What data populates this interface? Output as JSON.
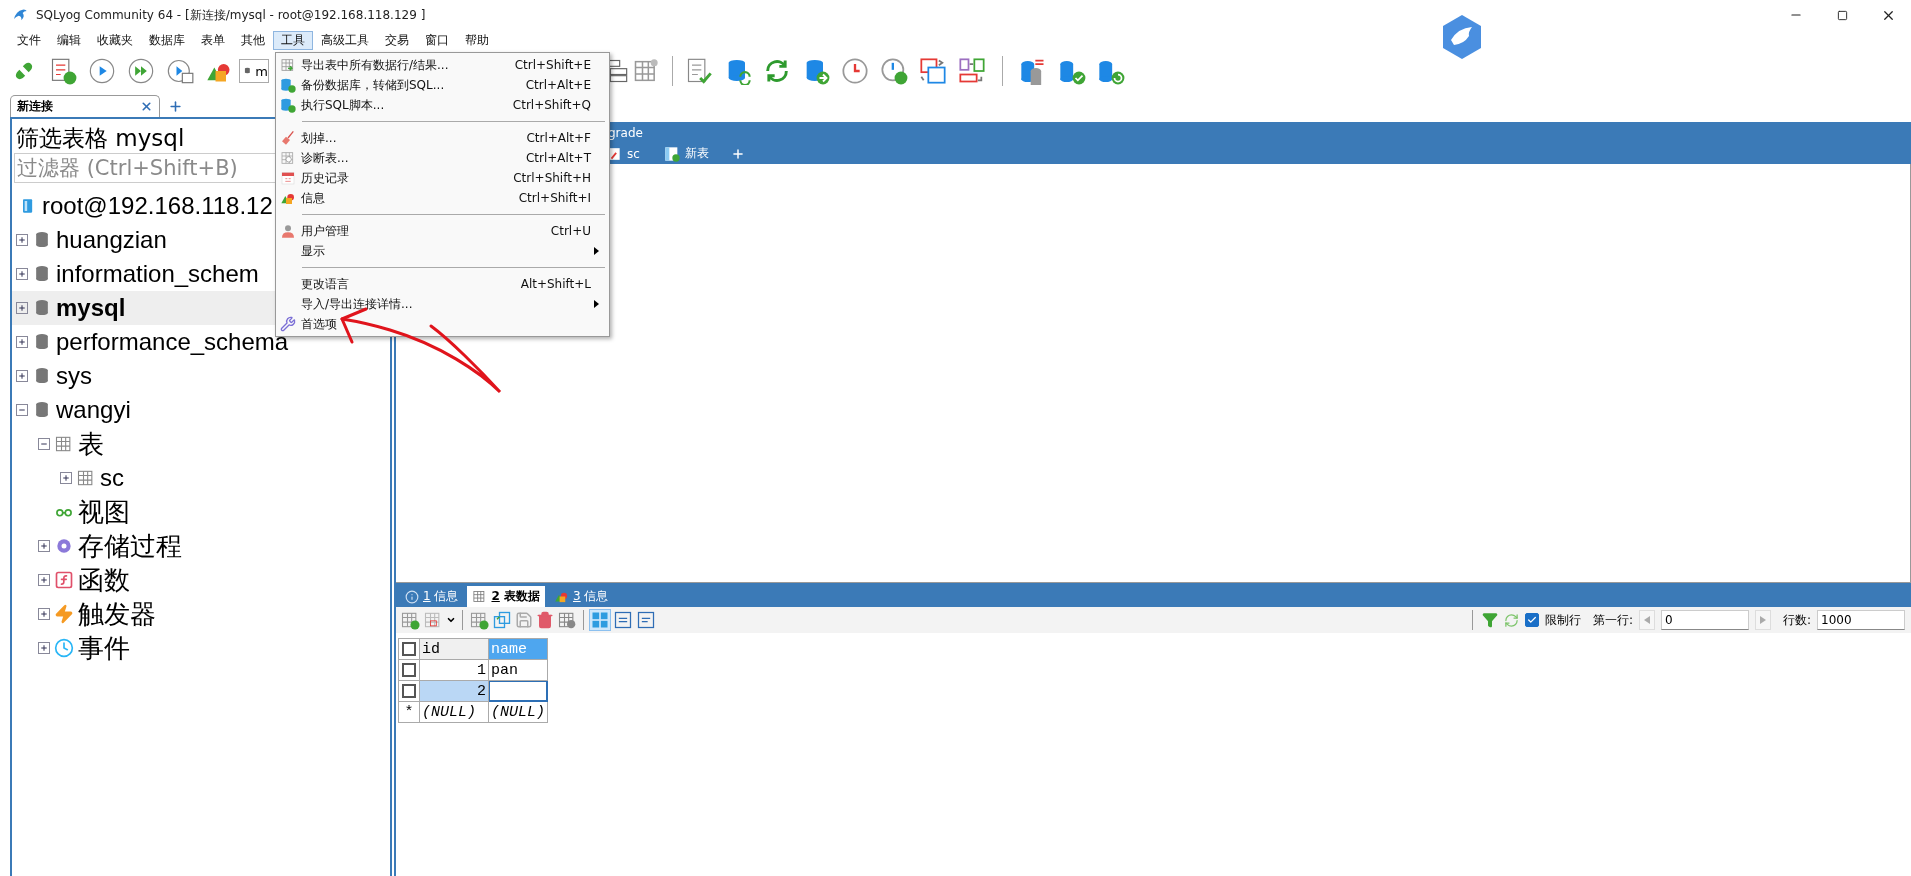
{
  "window": {
    "title": "SQLyog Community 64 - [新连接/mysql - root@192.168.118.129 ]"
  },
  "menu_bar": [
    {
      "label": "文件",
      "selected": false
    },
    {
      "label": "编辑",
      "selected": false
    },
    {
      "label": "收藏夹",
      "selected": false
    },
    {
      "label": "数据库",
      "selected": false
    },
    {
      "label": "表单",
      "selected": false
    },
    {
      "label": "其他",
      "selected": false
    },
    {
      "label": "工具",
      "selected": true
    },
    {
      "label": "高级工具",
      "selected": false
    },
    {
      "label": "交易",
      "selected": false
    },
    {
      "label": "窗口",
      "selected": false
    },
    {
      "label": "帮助",
      "selected": false
    }
  ],
  "toolbar": {
    "database_selector": {
      "value": "m"
    }
  },
  "connection_tabs": [
    {
      "label": "新连接",
      "selected": true
    }
  ],
  "object_browser": {
    "heading": "筛选表格 mysql",
    "filter": {
      "placeholder": "过滤器 (Ctrl+Shift+B)"
    },
    "tree": [
      {
        "label": "root@192.168.118.12",
        "kind": "connection",
        "selected": false,
        "children": [
          {
            "label": "huangzian",
            "kind": "database",
            "expanded": false,
            "selected": false
          },
          {
            "label": "information_schem",
            "kind": "database",
            "expanded": false,
            "selected": false
          },
          {
            "label": "mysql",
            "kind": "database",
            "expanded": false,
            "selected": true
          },
          {
            "label": "performance_schema",
            "kind": "database",
            "expanded": false,
            "selected": false
          },
          {
            "label": "sys",
            "kind": "database",
            "expanded": false,
            "selected": false
          },
          {
            "label": "wangyi",
            "kind": "database",
            "expanded": true,
            "selected": false,
            "children": [
              {
                "label": "表",
                "kind": "tables-folder",
                "expanded": true,
                "selected": false,
                "children": [
                  {
                    "label": "sc",
                    "kind": "table",
                    "expanded": false,
                    "selected": false
                  }
                ]
              },
              {
                "label": "视图",
                "kind": "views-folder",
                "selected": false
              },
              {
                "label": "存储过程",
                "kind": "procedures-folder",
                "expanded": false,
                "selected": false
              },
              {
                "label": "函数",
                "kind": "functions-folder",
                "expanded": false,
                "selected": false
              },
              {
                "label": "触发器",
                "kind": "triggers-folder",
                "expanded": false,
                "selected": false
              },
              {
                "label": "事件",
                "kind": "events-folder",
                "expanded": false,
                "selected": false
              }
            ]
          }
        ]
      }
    ]
  },
  "query_tabs": [
    [
      {
        "label": "grade",
        "kind": "plain"
      }
    ],
    [
      {
        "label": "sc",
        "kind": "table"
      },
      {
        "label": "新表",
        "kind": "new-table"
      }
    ]
  ],
  "result_tabs": [
    {
      "number": "1",
      "label": "信息",
      "kind": "info",
      "selected": false
    },
    {
      "number": "2",
      "label": "表数据",
      "kind": "table",
      "selected": true
    },
    {
      "number": "3",
      "label": "信息",
      "kind": "shapes",
      "selected": false
    }
  ],
  "result_toolbar": {
    "limit_rows": {
      "label": "限制行",
      "checked": true
    },
    "first_row": {
      "label": "第一行:",
      "value": "0"
    },
    "row_count": {
      "label": "行数:",
      "value": "1000"
    }
  },
  "result_grid": {
    "all_checked": false,
    "columns": [
      {
        "label": "id",
        "kind": "number",
        "selected": false
      },
      {
        "label": "name",
        "kind": "text",
        "selected": true
      }
    ],
    "rows": [
      {
        "kind": "data",
        "checked": false,
        "cells": [
          {
            "text": "1",
            "selected": false,
            "focused": false
          },
          {
            "text": "pan",
            "selected": false,
            "focused": false
          }
        ]
      },
      {
        "kind": "data",
        "checked": false,
        "cells": [
          {
            "text": "2",
            "selected": true,
            "focused": false
          },
          {
            "selected": false,
            "focused": true
          }
        ]
      },
      {
        "kind": "new",
        "marker": "*",
        "cells": [
          {
            "text": "(NULL)",
            "selected": false,
            "focused": false
          },
          {
            "text": "(NULL)",
            "selected": false,
            "focused": false
          }
        ]
      }
    ]
  },
  "open_menu": {
    "items": [
      {
        "kind": "item",
        "label": "导出表中所有数据行/结果...",
        "shortcut": "Ctrl+Shift+E",
        "submenu": false
      },
      {
        "kind": "item",
        "label": "备份数据库，转储到SQL...",
        "shortcut": "Ctrl+Alt+E",
        "submenu": false
      },
      {
        "kind": "item",
        "label": "执行SQL脚本...",
        "shortcut": "Ctrl+Shift+Q",
        "submenu": false
      },
      {
        "kind": "separator"
      },
      {
        "kind": "item",
        "label": "划掉...",
        "shortcut": "Ctrl+Alt+F",
        "submenu": false
      },
      {
        "kind": "item",
        "label": "诊断表...",
        "shortcut": "Ctrl+Alt+T",
        "submenu": false
      },
      {
        "kind": "item",
        "label": "历史记录",
        "shortcut": "Ctrl+Shift+H",
        "submenu": false
      },
      {
        "kind": "item",
        "label": "信息",
        "shortcut": "Ctrl+Shift+I",
        "submenu": false
      },
      {
        "kind": "separator"
      },
      {
        "kind": "item",
        "label": "用户管理",
        "shortcut": "Ctrl+U",
        "submenu": false
      },
      {
        "kind": "item",
        "label": "显示",
        "submenu": true
      },
      {
        "kind": "separator"
      },
      {
        "kind": "item",
        "label": "更改语言",
        "shortcut": "Alt+Shift+L",
        "submenu": false
      },
      {
        "kind": "item",
        "label": "导入/导出连接详情...",
        "submenu": true
      },
      {
        "kind": "item",
        "label": "首选项",
        "submenu": false
      }
    ]
  }
}
